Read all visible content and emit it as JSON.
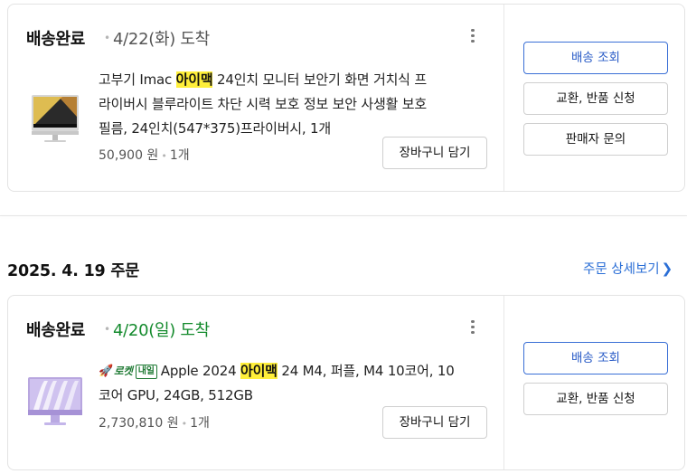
{
  "order1": {
    "status": "배송완료",
    "arrival": "4/22(화) 도착",
    "title_before": "고부기 Imac ",
    "title_highlight": "아이맥",
    "title_after": " 24인치 모니터 보안기 화면 거치식 프",
    "title_line2": "라이버시 블루라이트 차단 시력 보호 정보 보안 사생활 보호",
    "title_line3": "필름, 24인치(547*375)프라이버시, 1개",
    "price": "50,900 원",
    "quantity": "1개",
    "cart_button": "장바구니 담기",
    "actions": [
      "배송 조회",
      "교환, 반품 신청",
      "판매자 문의"
    ]
  },
  "order_group": {
    "date": "2025. 4. 19 주문",
    "detail_link": "주문 상세보기"
  },
  "order2": {
    "status": "배송완료",
    "arrival": "4/20(일) 도착",
    "badge_rocket": "로켓",
    "badge_tomorrow": "내일",
    "title_before": "Apple 2024 ",
    "title_highlight": "아이맥",
    "title_after": " 24 M4, 퍼플, M4 10코어, 10",
    "title_line2": "코어 GPU, 24GB, 512GB",
    "price": "2,730,810 원",
    "quantity": "1개",
    "cart_button": "장바구니 담기",
    "actions": [
      "배송 조회",
      "교환, 반품 신청"
    ]
  },
  "colors": {
    "highlight": "#ffef3a",
    "arrival_green": "#138a2c",
    "link_blue": "#2a6ed6",
    "primary_button_border": "#3a6fd6"
  }
}
